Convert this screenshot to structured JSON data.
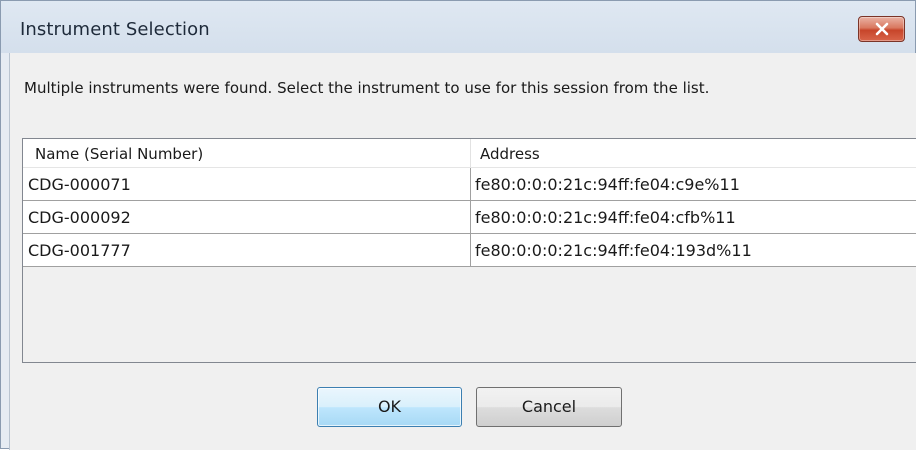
{
  "window": {
    "title": "Instrument Selection"
  },
  "message": "Multiple instruments were found. Select the instrument to use for this session from the list.",
  "list": {
    "columns": [
      "Name (Serial Number)",
      "Address"
    ],
    "rows": [
      {
        "name": "CDG-000071",
        "address": "fe80:0:0:0:21c:94ff:fe04:c9e%11"
      },
      {
        "name": "CDG-000092",
        "address": "fe80:0:0:0:21c:94ff:fe04:cfb%11"
      },
      {
        "name": "CDG-001777",
        "address": "fe80:0:0:0:21c:94ff:fe04:193d%11"
      }
    ]
  },
  "buttons": {
    "ok": "OK",
    "cancel": "Cancel"
  },
  "icons": {
    "close": "close-icon"
  },
  "colors": {
    "close_button": "#c7452a",
    "default_button_border": "#3c7fb1"
  }
}
